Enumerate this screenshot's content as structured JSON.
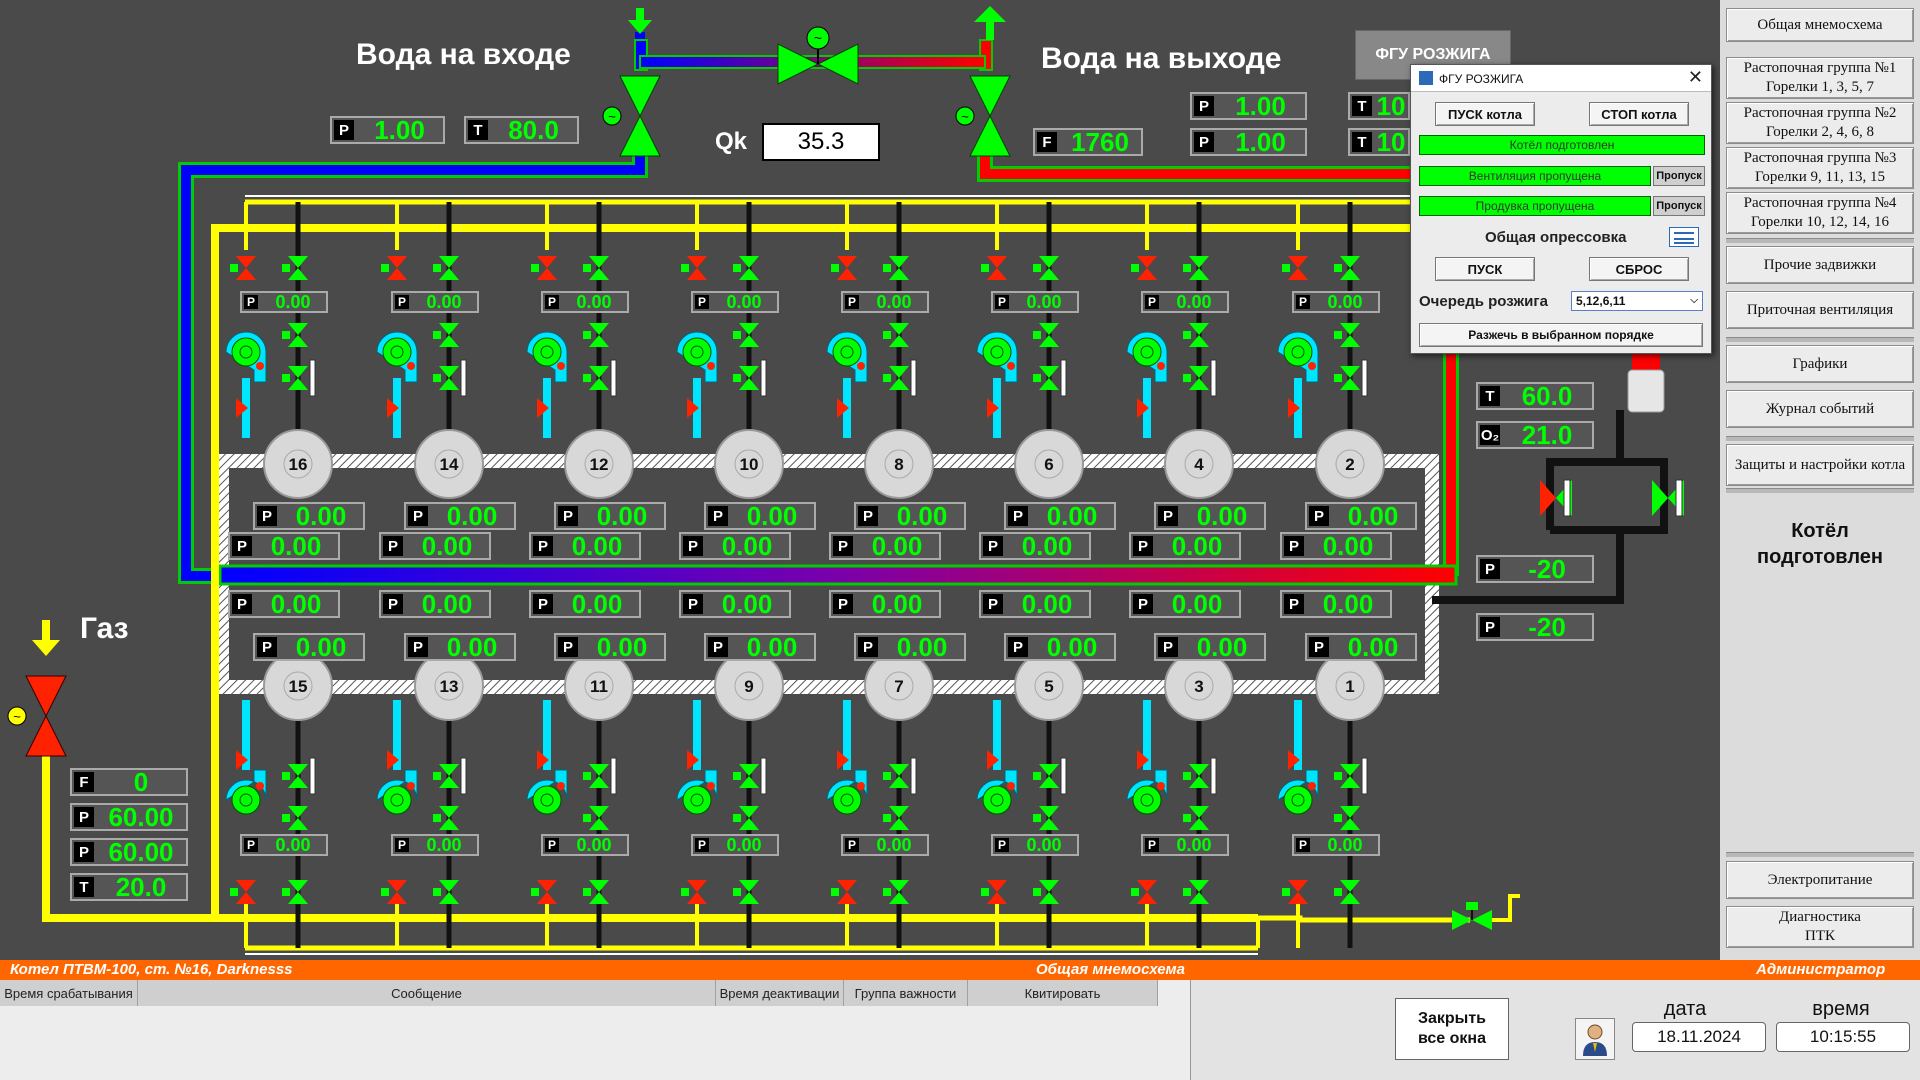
{
  "header": {
    "water_in_label": "Вода на входе",
    "water_out_label": "Вода на выходе",
    "qk_label": "Qk",
    "qk_value": "35.3",
    "gas_label": "Газ",
    "tilde": "~"
  },
  "inlet": {
    "p": "1.00",
    "t": "80.0"
  },
  "outlet": {
    "f": "1760",
    "p1": "1.00",
    "p2": "1.00",
    "t1": "10",
    "t2": "10"
  },
  "letters": {
    "P": "P",
    "T": "T",
    "F": "F",
    "O2": "O₂"
  },
  "gas": {
    "f": "0",
    "p1": "60.00",
    "p2": "60.00",
    "t": "20.0"
  },
  "right_meters": {
    "t": "60.0",
    "o2": "21.0",
    "p1": "-20",
    "p2": "-20"
  },
  "burners_top": [
    {
      "num": "16",
      "p_small": "0.00",
      "p_a": "0.00",
      "p_b": "0.00"
    },
    {
      "num": "14",
      "p_small": "0.00",
      "p_a": "0.00",
      "p_b": "0.00"
    },
    {
      "num": "12",
      "p_small": "0.00",
      "p_a": "0.00",
      "p_b": "0.00"
    },
    {
      "num": "10",
      "p_small": "0.00",
      "p_a": "0.00",
      "p_b": "0.00"
    },
    {
      "num": "8",
      "p_small": "0.00",
      "p_a": "0.00",
      "p_b": "0.00"
    },
    {
      "num": "6",
      "p_small": "0.00",
      "p_a": "0.00",
      "p_b": "0.00"
    },
    {
      "num": "4",
      "p_small": "0.00",
      "p_a": "0.00",
      "p_b": "0.00"
    },
    {
      "num": "2",
      "p_small": "0.00",
      "p_a": "0.00",
      "p_b": "0.00"
    }
  ],
  "burners_bottom": [
    {
      "num": "15",
      "p_small": "0.00",
      "p_a": "0.00",
      "p_b": "0.00"
    },
    {
      "num": "13",
      "p_small": "0.00",
      "p_a": "0.00",
      "p_b": "0.00"
    },
    {
      "num": "11",
      "p_small": "0.00",
      "p_a": "0.00",
      "p_b": "0.00"
    },
    {
      "num": "9",
      "p_small": "0.00",
      "p_a": "0.00",
      "p_b": "0.00"
    },
    {
      "num": "7",
      "p_small": "0.00",
      "p_a": "0.00",
      "p_b": "0.00"
    },
    {
      "num": "5",
      "p_small": "0.00",
      "p_a": "0.00",
      "p_b": "0.00"
    },
    {
      "num": "3",
      "p_small": "0.00",
      "p_a": "0.00",
      "p_b": "0.00"
    },
    {
      "num": "1",
      "p_small": "0.00",
      "p_a": "0.00",
      "p_b": "0.00"
    }
  ],
  "popup": {
    "tab_label": "ФГУ РОЗЖИГА",
    "title": "ФГУ РОЗЖИГА",
    "close": "✕",
    "start_boiler": "ПУСК котла",
    "stop_boiler": "СТОП котла",
    "status_ready": "Котёл подготовлен",
    "status_vent": "Вентиляция пропущена",
    "status_purge": "Продувка пропущена",
    "skip": "Пропуск",
    "pressure_test": "Общая опрессовка",
    "start": "ПУСК",
    "reset": "СБРОС",
    "queue_label": "Очередь розжига",
    "queue_value": "5,12,6,11",
    "ignite_order": "Разжечь в выбранном порядке"
  },
  "nav": {
    "items": [
      "Общая мнемосхема",
      "Растопочная группа №1\nГорелки 1, 3, 5, 7",
      "Растопочная группа №2\nГорелки 2, 4, 6, 8",
      "Растопочная группа №3\nГорелки 9, 11, 13, 15",
      "Растопочная группа №4\nГорелки 10, 12, 14, 16",
      "Прочие задвижки",
      "Приточная вентиляция",
      "Графики",
      "Журнал событий",
      "Защиты и настройки котла",
      "Электропитание",
      "Диагностика\nПТК"
    ],
    "status": "Котёл\nподготовлен"
  },
  "statusbar": {
    "left": "Котел ПТВМ-100, ст. №16, Darknesss",
    "center": "Общая мнемосхема",
    "right": "Администратор"
  },
  "events": {
    "columns": [
      "Время срабатывания",
      "Сообщение",
      "Время деактивации",
      "Группа важности",
      "Квитировать"
    ]
  },
  "bottom": {
    "close_windows": "Закрыть\nвсе окна",
    "date_label": "дата",
    "date_value": "18.11.2024",
    "time_label": "время",
    "time_value": "10:15:55"
  },
  "colors": {
    "background": "#4a4a4a",
    "gas_pipe": "#ffff00",
    "cold_water": "#0000ff",
    "hot_water": "#ff0000",
    "valve_green": "#00ff00",
    "valve_red": "#ff2200",
    "fan": "#00e5ff",
    "accent_bar": "#ff6600",
    "digits": "#00ff00"
  }
}
